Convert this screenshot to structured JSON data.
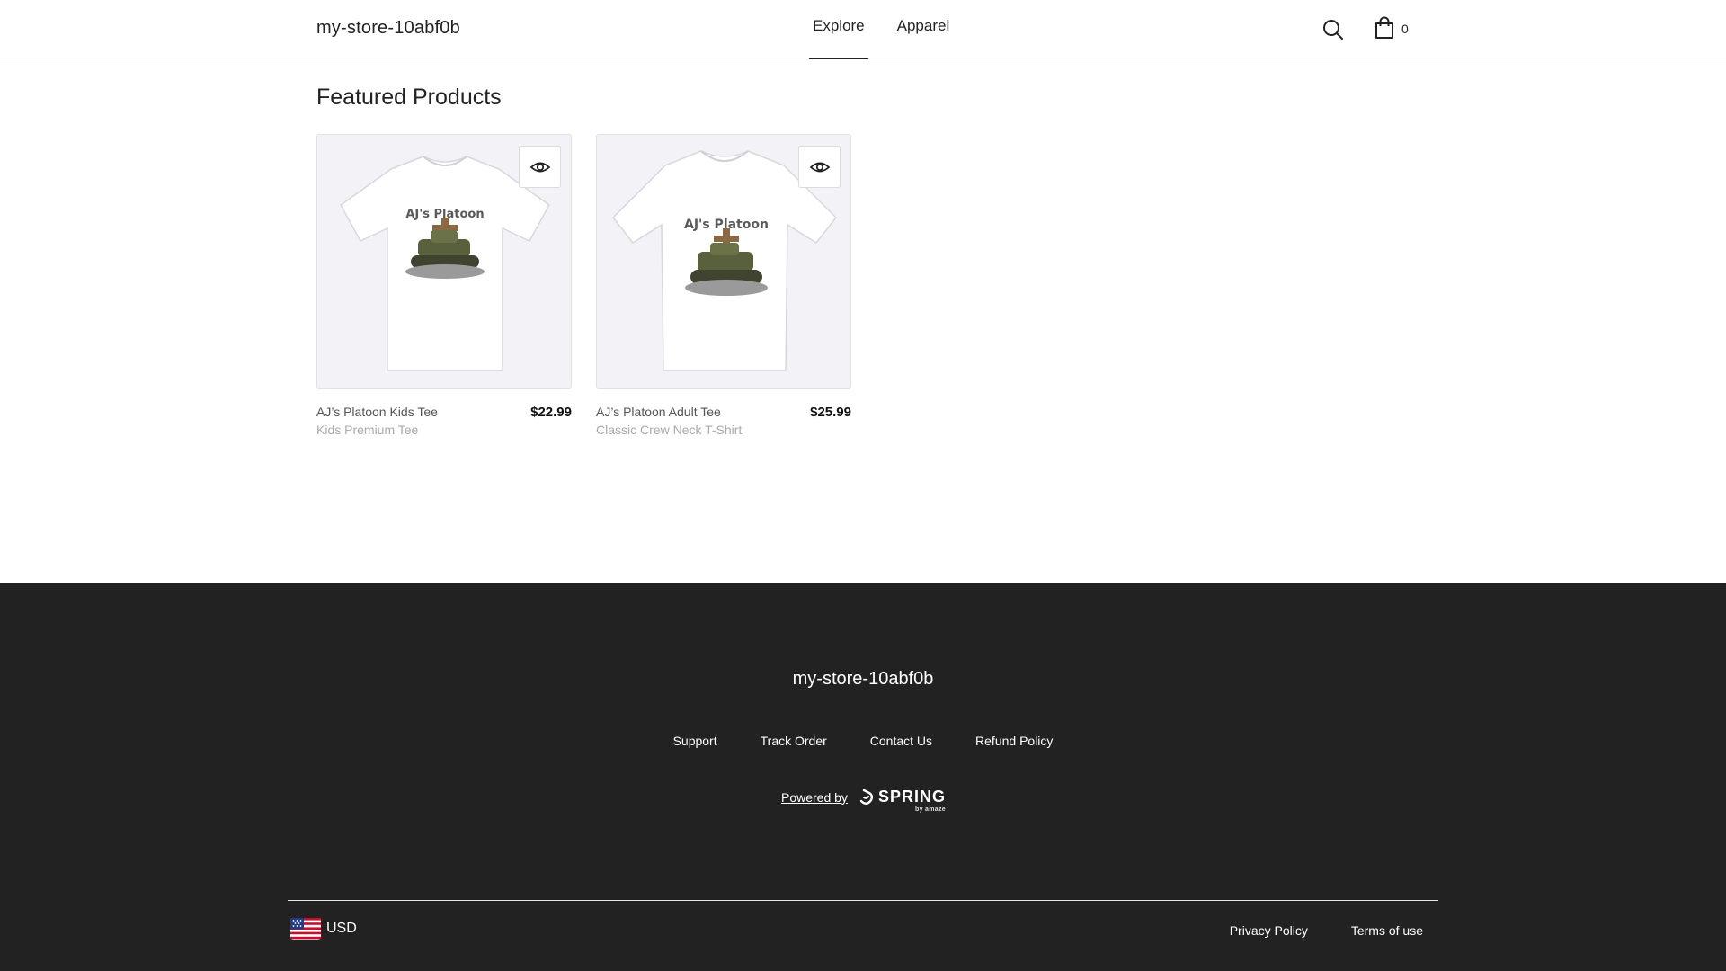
{
  "header": {
    "store_name": "my-store-10abf0b",
    "nav": [
      {
        "label": "Explore",
        "active": true
      },
      {
        "label": "Apparel",
        "active": false
      }
    ],
    "search_icon": "search-icon",
    "cart_icon": "shopping-bag-icon",
    "cart_count": "0"
  },
  "main": {
    "section_title": "Featured Products",
    "products": [
      {
        "name": "AJ’s Platoon Kids Tee",
        "type": "Kids Premium Tee",
        "price": "$22.99",
        "print_text": "AJ's Platoon"
      },
      {
        "name": "AJ’s Platoon Adult Tee",
        "type": "Classic Crew Neck T-Shirt",
        "price": "$25.99",
        "print_text": "AJ's Platoon"
      }
    ]
  },
  "footer": {
    "store_name": "my-store-10abf0b",
    "links": [
      "Support",
      "Track Order",
      "Contact Us",
      "Refund Policy"
    ],
    "powered_by": "Powered by",
    "brand": "SPRING",
    "brand_sub": "by amaze",
    "currency": "USD",
    "legal": [
      "Privacy Policy",
      "Terms of use"
    ]
  },
  "colors": {
    "footer_bg": "#222222",
    "accent": "#222222"
  }
}
